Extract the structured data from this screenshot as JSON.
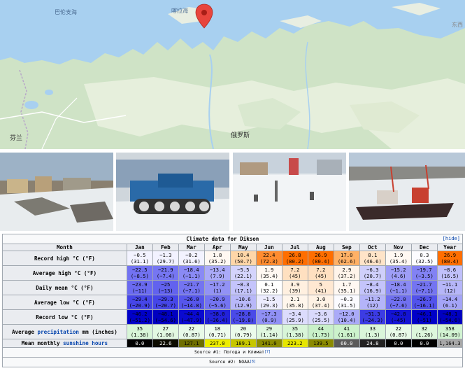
{
  "map": {
    "labels": {
      "barents": "巴伦支海",
      "kara": "喀拉海",
      "finland": "芬兰",
      "russia": "俄罗斯",
      "east": "东西"
    },
    "marker": "location-pin-icon",
    "colors": {
      "sea": "#a8d0f0",
      "land": "#cfe3c6",
      "land_light": "#e6efdc",
      "border": "#c8b8c8",
      "road": "#ffffff"
    }
  },
  "photos": [
    {
      "name": "town-view-photo",
      "icon": "town-photo"
    },
    {
      "name": "tracked-vehicle-photo",
      "icon": "vehicle-photo"
    },
    {
      "name": "snowy-square-photo",
      "icon": "square-photo"
    },
    {
      "name": "port-ships-photo",
      "icon": "port-photo"
    }
  ],
  "climate": {
    "title": "Climate data for Dikson",
    "hide_label": "[hide]",
    "month_header": "Month",
    "months": [
      "Jan",
      "Feb",
      "Mar",
      "Apr",
      "May",
      "Jun",
      "Jul",
      "Aug",
      "Sep",
      "Oct",
      "Nov",
      "Dec",
      "Year"
    ],
    "rows": [
      {
        "label": "Record high °C (°F)",
        "type": "temp",
        "cells": [
          [
            "−0.5",
            "(31.1)"
          ],
          [
            "−1.3",
            "(29.7)"
          ],
          [
            "−0.2",
            "(31.6)"
          ],
          [
            "1.8",
            "(35.2)"
          ],
          [
            "10.4",
            "(50.7)"
          ],
          [
            "22.4",
            "(72.3)"
          ],
          [
            "26.8",
            "(80.2)"
          ],
          [
            "26.9",
            "(80.4)"
          ],
          [
            "17.0",
            "(62.6)"
          ],
          [
            "8.1",
            "(46.6)"
          ],
          [
            "1.9",
            "(35.4)"
          ],
          [
            "0.3",
            "(32.5)"
          ],
          [
            "26.9",
            "(80.4)"
          ]
        ],
        "colors": [
          "#f3f3ff",
          "#f2f2ff",
          "#f3f3ff",
          "#fff8f2",
          "#ffd6a8",
          "#ff8c30",
          "#ff6e00",
          "#ff6e00",
          "#ffb166",
          "#ffe4c8",
          "#fff8f2",
          "#fcfcff",
          "#ff6e00"
        ]
      },
      {
        "label": "Average high °C (°F)",
        "type": "temp",
        "cells": [
          [
            "−22.5",
            "(−8.5)"
          ],
          [
            "−21.9",
            "(−7.4)"
          ],
          [
            "−18.4",
            "(−1.1)"
          ],
          [
            "−13.4",
            "(7.9)"
          ],
          [
            "−5.5",
            "(22.1)"
          ],
          [
            "1.9",
            "(35.4)"
          ],
          [
            "7.2",
            "(45)"
          ],
          [
            "7.2",
            "(45)"
          ],
          [
            "2.9",
            "(37.2)"
          ],
          [
            "−6.3",
            "(20.7)"
          ],
          [
            "−15.2",
            "(4.6)"
          ],
          [
            "−19.7",
            "(−3.5)"
          ],
          [
            "−8.6",
            "(16.5)"
          ]
        ],
        "colors": [
          "#7272f2",
          "#7676f2",
          "#8a8af5",
          "#aaaaf8",
          "#d4d4fc",
          "#fff8f2",
          "#ffe0c0",
          "#ffe0c0",
          "#fff4ea",
          "#cfcffb",
          "#9e9ef7",
          "#8282f4",
          "#c0c0fa"
        ]
      },
      {
        "label": "Daily mean °C (°F)",
        "type": "temp",
        "cells": [
          [
            "−23.9",
            "(−11)"
          ],
          [
            "−25",
            "(−13)"
          ],
          [
            "−21.7",
            "(−7.1)"
          ],
          [
            "−17.2",
            "(1)"
          ],
          [
            "−8.3",
            "(17.1)"
          ],
          [
            "0.1",
            "(32.2)"
          ],
          [
            "3.9",
            "(39)"
          ],
          [
            "5",
            "(41)"
          ],
          [
            "1.7",
            "(35.1)"
          ],
          [
            "−8.4",
            "(16.9)"
          ],
          [
            "−18.4",
            "(−1.1)"
          ],
          [
            "−21.7",
            "(−7.1)"
          ],
          [
            "−11.1",
            "(12)"
          ]
        ],
        "colors": [
          "#6a6af0",
          "#6262ee",
          "#7474f1",
          "#9292f5",
          "#c4c4fb",
          "#ffffff",
          "#fff0e0",
          "#ffe8d2",
          "#fff8f2",
          "#c4c4fb",
          "#8a8af4",
          "#7474f1",
          "#b6b6f9"
        ]
      },
      {
        "label": "Average low °C (°F)",
        "type": "temp",
        "cells": [
          [
            "−29.4",
            "(−20.9)"
          ],
          [
            "−29.3",
            "(−20.7)"
          ],
          [
            "−26.0",
            "(−14.8)"
          ],
          [
            "−20.9",
            "(−5.6)"
          ],
          [
            "−10.6",
            "(12.9)"
          ],
          [
            "−1.5",
            "(29.3)"
          ],
          [
            "2.1",
            "(35.8)"
          ],
          [
            "3.0",
            "(37.4)"
          ],
          [
            "−0.3",
            "(31.5)"
          ],
          [
            "−11.2",
            "(12)"
          ],
          [
            "−22.0",
            "(−7.6)"
          ],
          [
            "−26.7",
            "(−16.1)"
          ],
          [
            "−14.4",
            "(6.1)"
          ]
        ],
        "colors": [
          "#4646e8",
          "#4646e8",
          "#5656ec",
          "#7474f1",
          "#b8b8f9",
          "#ececfe",
          "#fff6ec",
          "#fff2e4",
          "#fbfbff",
          "#b4b4f9",
          "#7070f0",
          "#5252eb",
          "#a4a4f7"
        ]
      },
      {
        "label": "Record low °C (°F)",
        "type": "temp",
        "cells": [
          [
            "−46.2",
            "(−51.2)"
          ],
          [
            "−48.1",
            "(−54.6)"
          ],
          [
            "−44.4",
            "(−47.9)"
          ],
          [
            "−38.0",
            "(−36.4)"
          ],
          [
            "−28.8",
            "(−19.8)"
          ],
          [
            "−17.3",
            "(0.9)"
          ],
          [
            "−3.4",
            "(25.9)"
          ],
          [
            "−3.6",
            "(25.5)"
          ],
          [
            "−12.0",
            "(10.4)"
          ],
          [
            "−31.3",
            "(−24.3)"
          ],
          [
            "−42.8",
            "(−45)"
          ],
          [
            "−46.1",
            "(−51)"
          ],
          [
            "−48.1",
            "(−54.6)"
          ]
        ],
        "colors": [
          "#0000c8",
          "#0000c0",
          "#0a0ad0",
          "#2222da",
          "#4a4ae8",
          "#9090f5",
          "#dcdcfd",
          "#dadafc",
          "#aaaaf8",
          "#3c3ce4",
          "#1414d4",
          "#0000c8",
          "#0000c0"
        ]
      },
      {
        "label_pre": "Average ",
        "label_link": "precipitation",
        "label_post": " mm (inches)",
        "type": "precip",
        "cells": [
          [
            "35",
            "(1.38)"
          ],
          [
            "27",
            "(1.06)"
          ],
          [
            "22",
            "(0.87)"
          ],
          [
            "18",
            "(0.71)"
          ],
          [
            "20",
            "(0.79)"
          ],
          [
            "29",
            "(1.14)"
          ],
          [
            "35",
            "(1.38)"
          ],
          [
            "44",
            "(1.73)"
          ],
          [
            "41",
            "(1.61)"
          ],
          [
            "33",
            "(1.3)"
          ],
          [
            "22",
            "(0.87)"
          ],
          [
            "32",
            "(1.26)"
          ],
          [
            "358",
            "(14.09)"
          ]
        ],
        "colors": [
          "#d8f5d8",
          "#e2f8e2",
          "#e8fae8",
          "#eefcee",
          "#ebfbeb",
          "#dff7df",
          "#d8f5d8",
          "#c8f0c8",
          "#ccf2cc",
          "#daf6da",
          "#e8fae8",
          "#dcf6dc",
          "#d2f4d2"
        ]
      },
      {
        "label_pre": "Mean monthly ",
        "label_link": "sunshine hours",
        "label_post": "",
        "type": "sun",
        "cells": [
          "0.0",
          "22.6",
          "127.1",
          "237.0",
          "189.1",
          "141.0",
          "223.2",
          "139.5",
          "60.0",
          "24.8",
          "0.0",
          "0.0",
          "1,164.3"
        ],
        "colors": [
          "#000000",
          "#0c0c00",
          "#6e6e00",
          "#eded00",
          "#c6c600",
          "#8c8c00",
          "#e6e600",
          "#8a8a00",
          "#5a5a5a",
          "#222222",
          "#000000",
          "#000000",
          "#a8a8a8"
        ],
        "text_colors": [
          "#ffffff",
          "#ffffff",
          "#000000",
          "#000000",
          "#000000",
          "#000000",
          "#000000",
          "#000000",
          "#ffffff",
          "#ffffff",
          "#ffffff",
          "#ffffff",
          "#000000"
        ]
      }
    ],
    "source1_pre": "Source #1: ",
    "source1_name": "Погода и Климат",
    "source1_ref": "[7]",
    "source2_pre": "Source #2: ",
    "source2_name": "NOAA",
    "source2_ref": "[8]"
  }
}
